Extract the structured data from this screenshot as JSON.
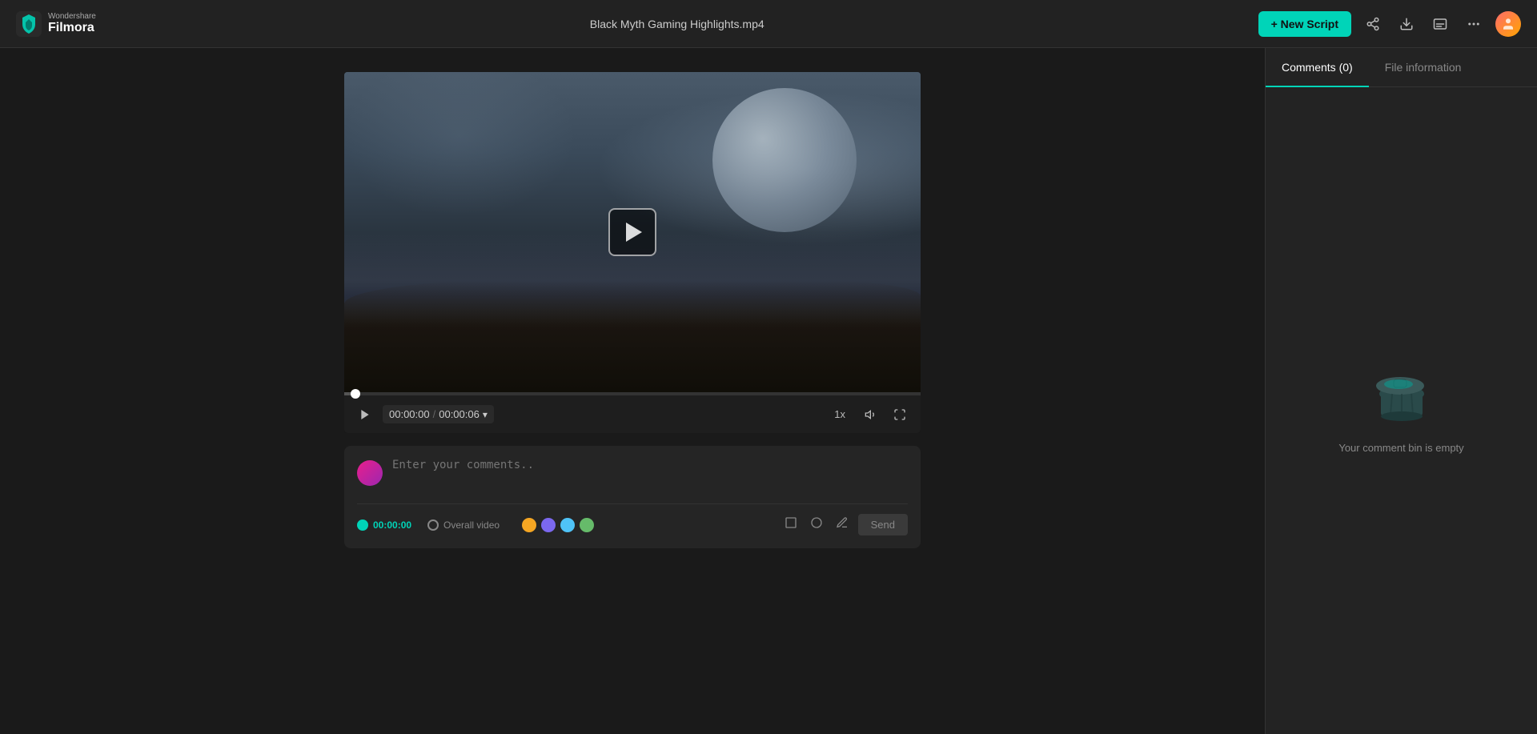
{
  "app": {
    "brand_top": "Wondershare",
    "brand_name": "Filmora",
    "file_title": "Black Myth Gaming Highlights.mp4"
  },
  "header": {
    "new_script_label": "+ New Script",
    "share_icon": "share-icon",
    "download_icon": "download-icon",
    "subtitles_icon": "subtitles-icon",
    "more_icon": "more-icon",
    "user_icon": "user-icon"
  },
  "video": {
    "current_time": "00:00:00",
    "total_time": "00:00:06",
    "speed": "1x",
    "progress_percent": 2
  },
  "sidebar": {
    "tabs": [
      {
        "id": "comments",
        "label": "Comments (0)",
        "active": true
      },
      {
        "id": "file-info",
        "label": "File information",
        "active": false
      }
    ],
    "empty_message": "Your comment bin is empty"
  },
  "comment": {
    "placeholder": "Enter your comments..",
    "timestamp": "00:00:00",
    "overall_label": "Overall video",
    "send_label": "Send",
    "colors": [
      "#f5a623",
      "#7b68ee",
      "#4fc3f7",
      "#66bb6a"
    ],
    "shapes": [
      "rect",
      "circle",
      "pen"
    ]
  }
}
